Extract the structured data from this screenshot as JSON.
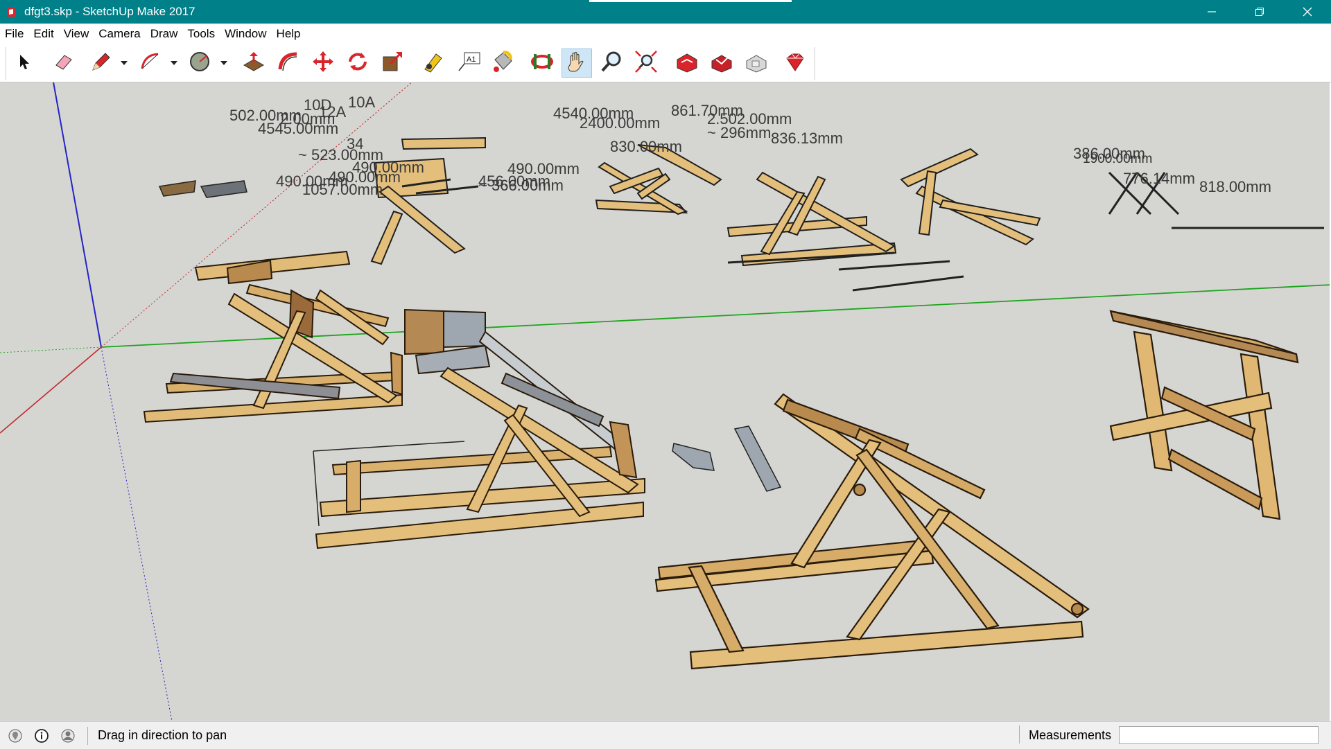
{
  "window": {
    "title": "dfgt3.skp - SketchUp Make 2017",
    "controls": [
      "minimize",
      "maximize",
      "close"
    ]
  },
  "menu": [
    "File",
    "Edit",
    "View",
    "Camera",
    "Draw",
    "Tools",
    "Window",
    "Help"
  ],
  "toolbar": {
    "tools": [
      {
        "name": "select",
        "icon": "arrow-icon"
      },
      {
        "name": "eraser",
        "icon": "eraser-icon"
      },
      {
        "name": "line",
        "icon": "pencil-icon",
        "dropdown": true
      },
      {
        "name": "arc",
        "icon": "arc-icon",
        "dropdown": true
      },
      {
        "name": "shapes",
        "icon": "circle-icon",
        "dropdown": true
      },
      {
        "name": "push-pull",
        "icon": "pushpull-icon"
      },
      {
        "name": "follow-me",
        "icon": "followme-icon"
      },
      {
        "name": "move",
        "icon": "move-icon"
      },
      {
        "name": "rotate",
        "icon": "rotate-icon"
      },
      {
        "name": "scale",
        "icon": "scale-icon"
      },
      {
        "name": "tape-measure",
        "icon": "tape-measure-icon"
      },
      {
        "name": "text",
        "icon": "text-icon"
      },
      {
        "name": "paint-bucket",
        "icon": "paint-bucket-icon"
      },
      {
        "name": "orbit",
        "icon": "orbit-icon"
      },
      {
        "name": "pan",
        "icon": "hand-icon",
        "active": true
      },
      {
        "name": "zoom",
        "icon": "magnifier-icon"
      },
      {
        "name": "zoom-extents",
        "icon": "zoom-extents-icon"
      },
      {
        "name": "3d-warehouse",
        "icon": "warehouse-icon"
      },
      {
        "name": "share-component",
        "icon": "share-component-icon"
      },
      {
        "name": "extension-warehouse",
        "icon": "extension-icon"
      },
      {
        "name": "ruby-console",
        "icon": "ruby-icon"
      }
    ],
    "text_tool_label": "A1"
  },
  "viewport": {
    "dimension_labels": [
      "502.00mm",
      "10D",
      "10A",
      "12A",
      "2.00mm",
      "4545.00mm",
      "~ 523.00mm",
      "34",
      "490.00mm",
      "490.00mm",
      "490.00mm",
      "1057.00mm",
      "456.00mm",
      "~ 366.00mm",
      "4540.00mm",
      "2400.00mm",
      "861.70mm",
      "2.502.00mm",
      "~ 296mm",
      "836.13mm",
      "830.00mm",
      "490.00mm",
      "386.00mm",
      "1900.00mm",
      "776.14mm",
      "818.00mm"
    ]
  },
  "status": {
    "message": "Drag in direction to pan",
    "measurements_label": "Measurements",
    "measurements_value": ""
  },
  "colors": {
    "titlebar": "#00818a",
    "viewport_bg": "#d5d5d1",
    "wood": "#e4bf7c",
    "metal": "#9ea7b0",
    "axis_red": "#c0282c",
    "axis_green": "#1da51d",
    "axis_blue": "#2424c8"
  }
}
